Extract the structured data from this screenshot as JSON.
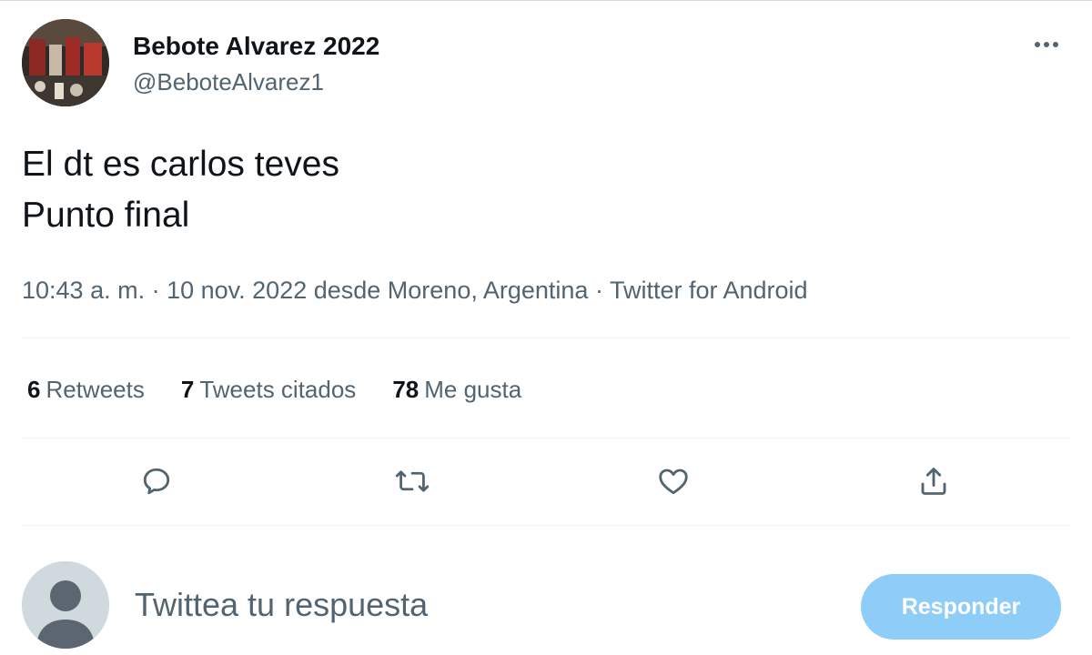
{
  "author": {
    "display_name": "Bebote Alvarez 2022",
    "handle": "@BeboteAlvarez1",
    "avatar_icon": "profile-photo"
  },
  "tweet": {
    "lines": [
      "El dt es carlos teves",
      "Punto final"
    ]
  },
  "meta": {
    "time": "10:43 a. m.",
    "separator": " · ",
    "date_location": "10 nov. 2022 desde Moreno, Argentina",
    "source": "Twitter for Android"
  },
  "stats": {
    "retweets": {
      "count": "6",
      "label": "Retweets"
    },
    "quotes": {
      "count": "7",
      "label": "Tweets citados"
    },
    "likes": {
      "count": "78",
      "label": "Me gusta"
    }
  },
  "actions": {
    "icons": [
      "reply-icon",
      "retweet-icon",
      "like-icon",
      "share-icon"
    ]
  },
  "reply": {
    "placeholder": "Twittea tu respuesta",
    "button_label": "Responder"
  },
  "colors": {
    "text_primary": "#0f1419",
    "text_secondary": "#536471",
    "button_disabled": "#8ecdf8",
    "divider": "#eff3f4"
  }
}
